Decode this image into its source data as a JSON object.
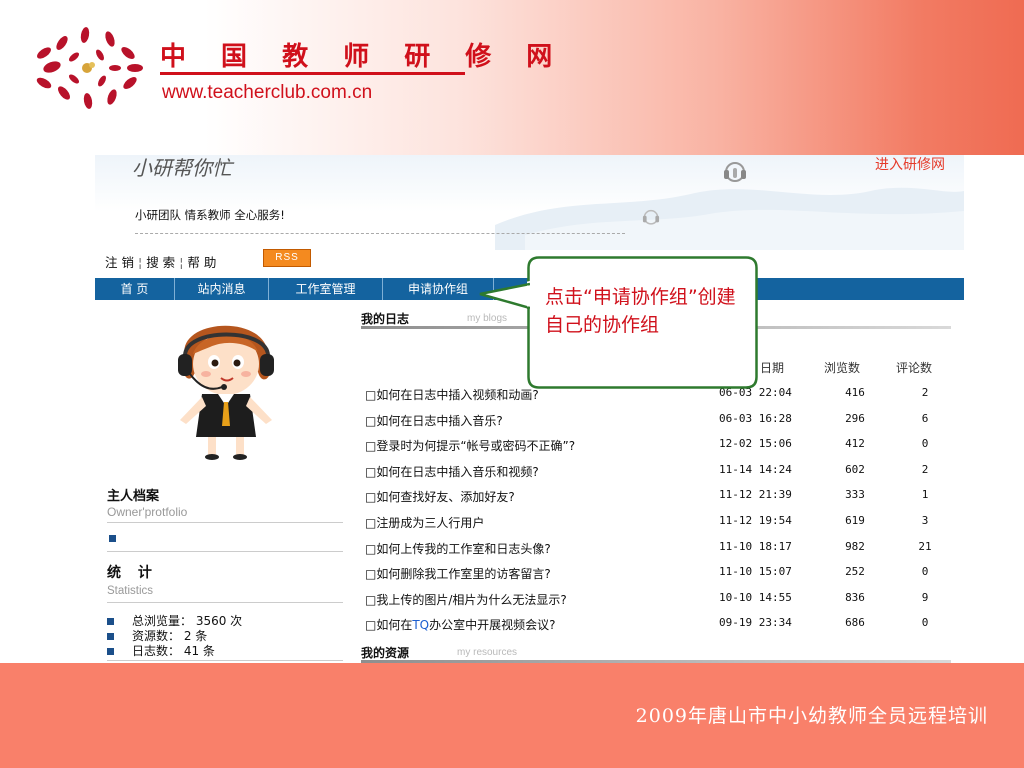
{
  "logo": {
    "title": "中 国 教 师 研 修 网",
    "url": "www.teacherclub.com.cn",
    "color": "#d0101b"
  },
  "banner": {
    "title": "小研帮你忙",
    "slogan": "小研团队 情系教师 全心服务!",
    "enter_link": "进入研修网"
  },
  "utility_links": [
    "注 销",
    "搜 索",
    "帮 助"
  ],
  "rss_label": "RSS",
  "nav": [
    "首 页",
    "站内消息",
    "工作室管理",
    "申请协作组"
  ],
  "callout_text": "点击“申请协作组”创建自己的协作组",
  "sidebar": {
    "owner_title": "主人档案",
    "owner_sub": "Owner'protfolio",
    "stats_title": "统 计",
    "stats_sub": "Statistics",
    "stats": [
      "总浏览量： 3560 次",
      "资源数： 2 条",
      "日志数： 41 条"
    ]
  },
  "blog": {
    "title": "我的日志",
    "title_en": "my blogs",
    "columns": {
      "date": "日期",
      "views": "浏览数",
      "comments": "评论数"
    },
    "posts": [
      {
        "title": "□如何在日志中插入视频和动画?",
        "date": "06-03 22:04",
        "views": "416",
        "comments": "2"
      },
      {
        "title": "□如何在日志中插入音乐?",
        "date": "06-03 16:28",
        "views": "296",
        "comments": "6"
      },
      {
        "title": "□登录时为何提示“帐号或密码不正确”?",
        "date": "12-02 15:06",
        "views": "412",
        "comments": "0"
      },
      {
        "title": "□如何在日志中插入音乐和视频?",
        "date": "11-14 14:24",
        "views": "602",
        "comments": "2"
      },
      {
        "title": "□如何查找好友、添加好友?",
        "date": "11-12 21:39",
        "views": "333",
        "comments": "1"
      },
      {
        "title": "□注册成为三人行用户",
        "date": "11-12 19:54",
        "views": "619",
        "comments": "3"
      },
      {
        "title": "□如何上传我的工作室和日志头像?",
        "date": "11-10 18:17",
        "views": "982",
        "comments": "21"
      },
      {
        "title": "□如何删除我工作室里的访客留言?",
        "date": "11-10 15:07",
        "views": "252",
        "comments": "0"
      },
      {
        "title": "□我上传的图片/相片为什么无法显示?",
        "date": "10-10 14:55",
        "views": "836",
        "comments": "9"
      },
      {
        "title_parts": [
          "□如何在",
          "TQ",
          "办公室中开展视频会议?"
        ],
        "date": "09-19 23:34",
        "views": "686",
        "comments": "0"
      }
    ]
  },
  "resources": {
    "title": "我的资源",
    "title_en": "my resources"
  },
  "footer_text": "2009年唐山市中小幼教师全员远程培训",
  "colors": {
    "nav_blue": "#14639f",
    "footer": "#f9806a",
    "callout_border": "#2e7a2e",
    "callout_text": "#d0101b"
  }
}
